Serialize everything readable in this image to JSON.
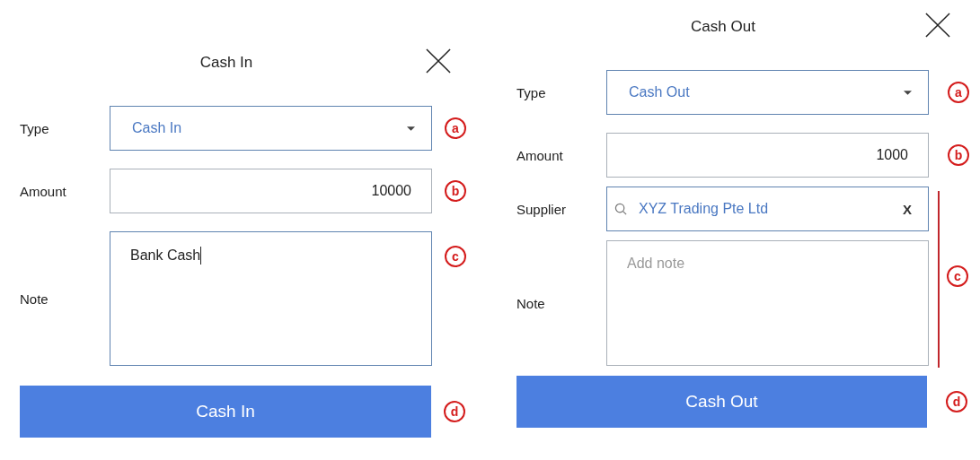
{
  "dialogs": [
    {
      "title": "Cash In",
      "rows": [
        {
          "kind": "select",
          "label": "Type",
          "value": "Cash In",
          "marker": "a"
        },
        {
          "kind": "number",
          "label": "Amount",
          "value": "10000",
          "marker": "b"
        },
        {
          "kind": "note",
          "label": "Note",
          "value": "Bank Cash",
          "focused": true,
          "marker": "c"
        }
      ],
      "button": {
        "label": "Cash In",
        "marker": "d"
      }
    },
    {
      "title": "Cash Out",
      "rows": [
        {
          "kind": "select",
          "label": "Type",
          "value": "Cash Out",
          "marker": "a"
        },
        {
          "kind": "number",
          "label": "Amount",
          "value": "1000",
          "marker": "b"
        },
        {
          "kind": "group",
          "marker": "c",
          "rows": [
            {
              "kind": "search",
              "label": "Supplier",
              "value": "XYZ Trading Pte Ltd",
              "clear": "X"
            },
            {
              "kind": "note",
              "label": "Note",
              "placeholder": "Add note",
              "focused": false
            }
          ]
        }
      ],
      "button": {
        "label": "Cash Out",
        "marker": "d"
      }
    }
  ]
}
